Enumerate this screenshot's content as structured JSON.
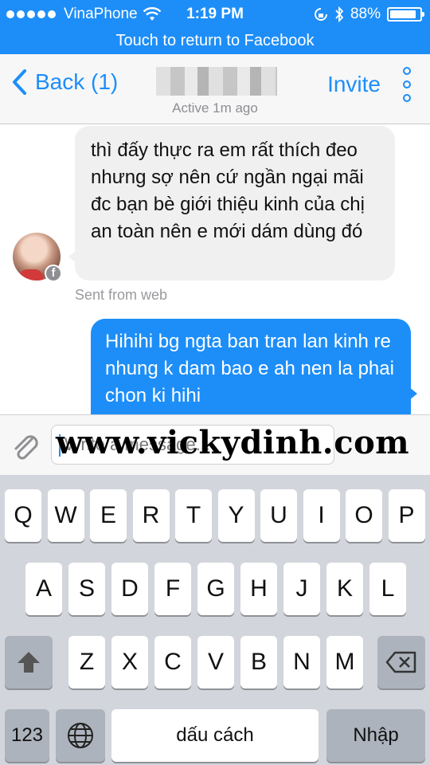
{
  "status_bar": {
    "carrier": "VinaPhone",
    "time": "1:19 PM",
    "battery": "88%",
    "battery_level": 0.88,
    "icons": [
      "signal-dots",
      "wifi-icon",
      "orientation-lock-icon",
      "bluetooth-icon",
      "battery-icon"
    ]
  },
  "banner": {
    "text": "Touch to return to Facebook"
  },
  "nav": {
    "back_label": "Back (1)",
    "subtitle": "Active 1m ago",
    "invite_label": "Invite"
  },
  "messages": [
    {
      "direction": "incoming",
      "text": "thì đấy thực ra em rất thích đeo nhưng sợ nên cứ ngần ngại mãi đc bạn bè giới thiệu kinh của chị an toàn nên e mới dám dùng đó"
    },
    {
      "direction": "outgoing",
      "text": "Hihihi bg ngta ban tran lan kinh re nhung k dam bao e ah nen la phai chon ki hihi"
    }
  ],
  "sent_from": "Sent from web",
  "composer": {
    "placeholder": "Write a message..."
  },
  "watermark": "www.vickydinh.com",
  "keyboard": {
    "row1": [
      "Q",
      "W",
      "E",
      "R",
      "T",
      "Y",
      "U",
      "I",
      "O",
      "P"
    ],
    "row2": [
      "A",
      "S",
      "D",
      "F",
      "G",
      "H",
      "J",
      "K",
      "L"
    ],
    "row3": [
      "Z",
      "X",
      "C",
      "V",
      "B",
      "N",
      "M"
    ],
    "numbers_label": "123",
    "space_label": "dấu cách",
    "return_label": "Nhập"
  },
  "colors": {
    "accent": "#1d8ef8",
    "keyboard_bg": "#d2d5db",
    "bubble_in": "#f1f0f0"
  }
}
